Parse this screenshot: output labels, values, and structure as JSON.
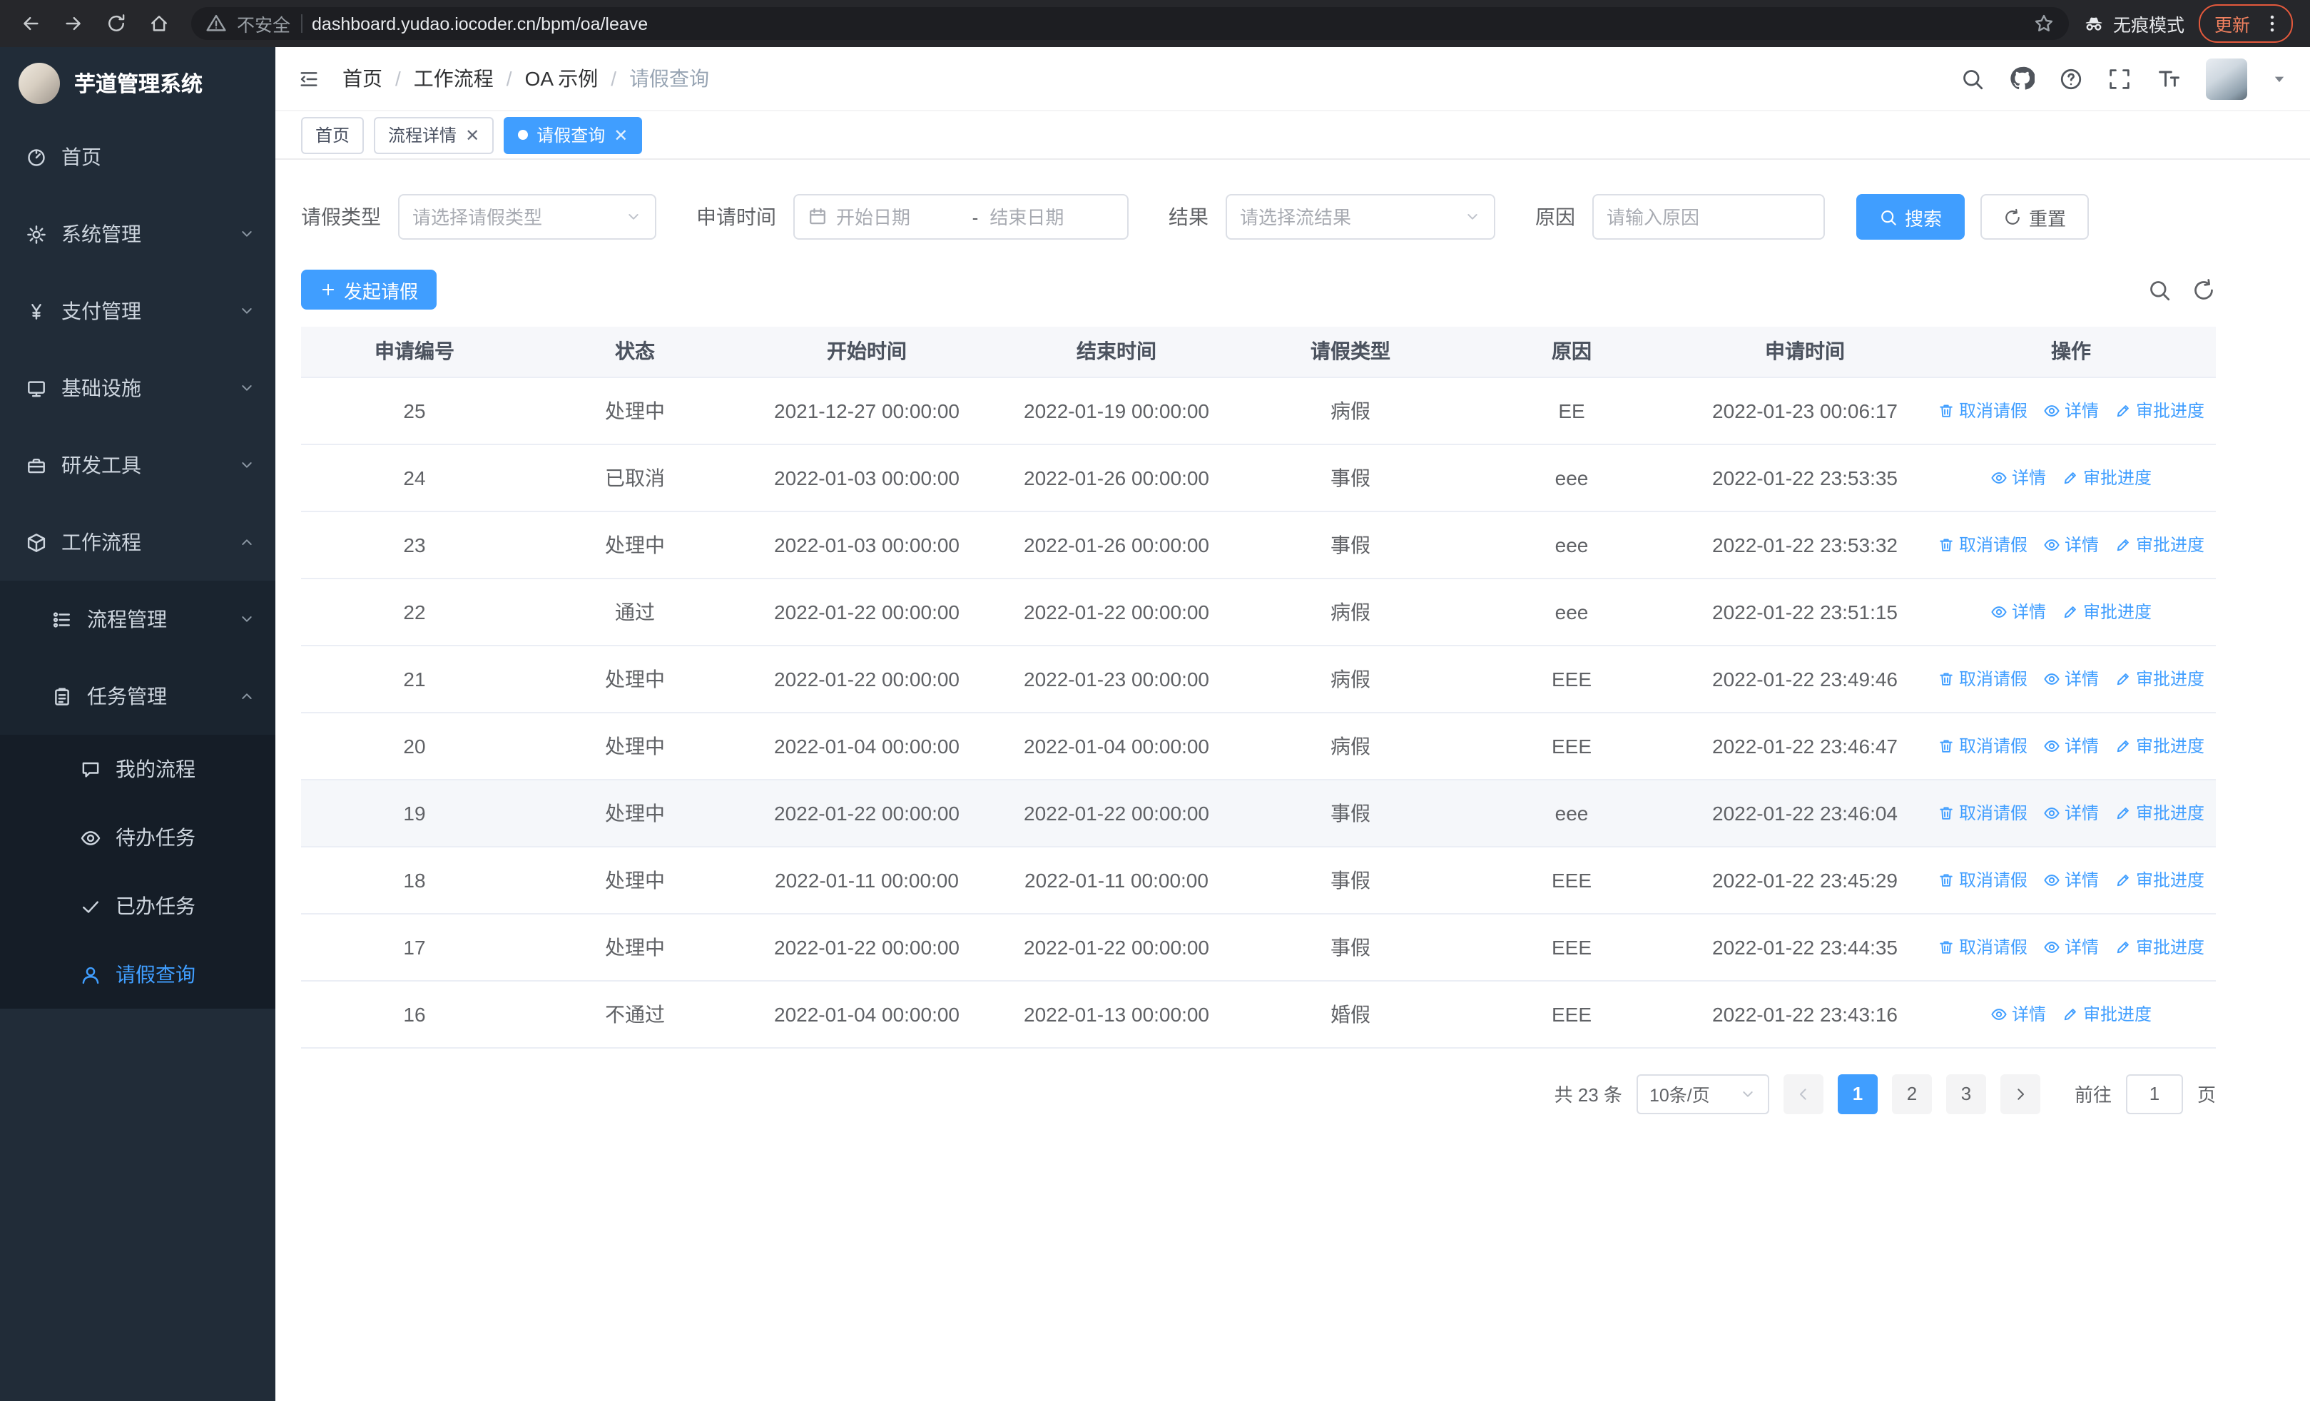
{
  "colors": {
    "primary": "#409eff",
    "sidebar_bg": "#212c38",
    "link": "#409eff"
  },
  "browser": {
    "security_label": "不安全",
    "url": "dashboard.yudao.iocoder.cn/bpm/oa/leave",
    "incognito_label": "无痕模式",
    "update_label": "更新"
  },
  "sidebar": {
    "logo_title": "芋道管理系统",
    "items": [
      {
        "key": "home",
        "label": "首页",
        "icon": "dashboard-icon",
        "depth": 0,
        "expandable": false
      },
      {
        "key": "system",
        "label": "系统管理",
        "icon": "gear-icon",
        "depth": 0,
        "expandable": true,
        "expanded": false
      },
      {
        "key": "payment",
        "label": "支付管理",
        "icon": "yen-icon",
        "depth": 0,
        "expandable": true,
        "expanded": false
      },
      {
        "key": "infra",
        "label": "基础设施",
        "icon": "monitor-icon",
        "depth": 0,
        "expandable": true,
        "expanded": false
      },
      {
        "key": "devtools",
        "label": "研发工具",
        "icon": "toolbox-icon",
        "depth": 0,
        "expandable": true,
        "expanded": false
      },
      {
        "key": "workflow",
        "label": "工作流程",
        "icon": "workflow-icon",
        "depth": 0,
        "expandable": true,
        "expanded": true
      },
      {
        "key": "process-mgmt",
        "label": "流程管理",
        "icon": "flow-icon",
        "depth": 1,
        "expandable": true,
        "expanded": false
      },
      {
        "key": "task-mgmt",
        "label": "任务管理",
        "icon": "task-icon",
        "depth": 1,
        "expandable": true,
        "expanded": true
      },
      {
        "key": "my-processes",
        "label": "我的流程",
        "icon": "chat-icon",
        "depth": 2,
        "expandable": false
      },
      {
        "key": "todo-tasks",
        "label": "待办任务",
        "icon": "eye-icon",
        "depth": 2,
        "expandable": false
      },
      {
        "key": "done-tasks",
        "label": "已办任务",
        "icon": "done-icon",
        "depth": 2,
        "expandable": false
      },
      {
        "key": "leave-query",
        "label": "请假查询",
        "icon": "user-icon",
        "depth": 2,
        "expandable": false,
        "active": true
      }
    ]
  },
  "header": {
    "breadcrumb": [
      "首页",
      "工作流程",
      "OA 示例",
      "请假查询"
    ]
  },
  "tabs": [
    {
      "key": "home",
      "label": "首页",
      "closable": false,
      "active": false
    },
    {
      "key": "process-detail",
      "label": "流程详情",
      "closable": true,
      "active": false
    },
    {
      "key": "leave-query",
      "label": "请假查询",
      "closable": true,
      "active": true
    }
  ],
  "filters": {
    "leave_type_label": "请假类型",
    "leave_type_placeholder": "请选择请假类型",
    "apply_time_label": "申请时间",
    "date_start_placeholder": "开始日期",
    "date_separator": "-",
    "date_end_placeholder": "结束日期",
    "result_label": "结果",
    "result_placeholder": "请选择流结果",
    "reason_label": "原因",
    "reason_placeholder": "请输入原因",
    "search_label": "搜索",
    "reset_label": "重置"
  },
  "toolbar": {
    "create_label": "发起请假"
  },
  "table": {
    "columns": [
      {
        "key": "id",
        "label": "申请编号"
      },
      {
        "key": "status",
        "label": "状态"
      },
      {
        "key": "start",
        "label": "开始时间"
      },
      {
        "key": "end",
        "label": "结束时间"
      },
      {
        "key": "type",
        "label": "请假类型"
      },
      {
        "key": "reason",
        "label": "原因"
      },
      {
        "key": "applied",
        "label": "申请时间"
      },
      {
        "key": "actions",
        "label": "操作"
      }
    ],
    "action_labels": {
      "cancel": {
        "label": "取消请假",
        "icon": "trash-icon"
      },
      "detail": {
        "label": "详情",
        "icon": "eye-icon"
      },
      "progress": {
        "label": "审批进度",
        "icon": "edit-icon"
      }
    },
    "rows": [
      {
        "id": "25",
        "status": "处理中",
        "start": "2021-12-27 00:00:00",
        "end": "2022-01-19 00:00:00",
        "type": "病假",
        "reason": "EE",
        "applied": "2022-01-23 00:06:17",
        "actions": [
          "cancel",
          "detail",
          "progress"
        ]
      },
      {
        "id": "24",
        "status": "已取消",
        "start": "2022-01-03 00:00:00",
        "end": "2022-01-26 00:00:00",
        "type": "事假",
        "reason": "eee",
        "applied": "2022-01-22 23:53:35",
        "actions": [
          "detail",
          "progress"
        ]
      },
      {
        "id": "23",
        "status": "处理中",
        "start": "2022-01-03 00:00:00",
        "end": "2022-01-26 00:00:00",
        "type": "事假",
        "reason": "eee",
        "applied": "2022-01-22 23:53:32",
        "actions": [
          "cancel",
          "detail",
          "progress"
        ]
      },
      {
        "id": "22",
        "status": "通过",
        "start": "2022-01-22 00:00:00",
        "end": "2022-01-22 00:00:00",
        "type": "病假",
        "reason": "eee",
        "applied": "2022-01-22 23:51:15",
        "actions": [
          "detail",
          "progress"
        ]
      },
      {
        "id": "21",
        "status": "处理中",
        "start": "2022-01-22 00:00:00",
        "end": "2022-01-23 00:00:00",
        "type": "病假",
        "reason": "EEE",
        "applied": "2022-01-22 23:49:46",
        "actions": [
          "cancel",
          "detail",
          "progress"
        ]
      },
      {
        "id": "20",
        "status": "处理中",
        "start": "2022-01-04 00:00:00",
        "end": "2022-01-04 00:00:00",
        "type": "病假",
        "reason": "EEE",
        "applied": "2022-01-22 23:46:47",
        "actions": [
          "cancel",
          "detail",
          "progress"
        ]
      },
      {
        "id": "19",
        "status": "处理中",
        "start": "2022-01-22 00:00:00",
        "end": "2022-01-22 00:00:00",
        "type": "事假",
        "reason": "eee",
        "applied": "2022-01-22 23:46:04",
        "actions": [
          "cancel",
          "detail",
          "progress"
        ],
        "highlight": true
      },
      {
        "id": "18",
        "status": "处理中",
        "start": "2022-01-11 00:00:00",
        "end": "2022-01-11 00:00:00",
        "type": "事假",
        "reason": "EEE",
        "applied": "2022-01-22 23:45:29",
        "actions": [
          "cancel",
          "detail",
          "progress"
        ]
      },
      {
        "id": "17",
        "status": "处理中",
        "start": "2022-01-22 00:00:00",
        "end": "2022-01-22 00:00:00",
        "type": "事假",
        "reason": "EEE",
        "applied": "2022-01-22 23:44:35",
        "actions": [
          "cancel",
          "detail",
          "progress"
        ]
      },
      {
        "id": "16",
        "status": "不通过",
        "start": "2022-01-04 00:00:00",
        "end": "2022-01-13 00:00:00",
        "type": "婚假",
        "reason": "EEE",
        "applied": "2022-01-22 23:43:16",
        "actions": [
          "detail",
          "progress"
        ]
      }
    ]
  },
  "pagination": {
    "total_label": "共 23 条",
    "page_size": "10条/页",
    "pages": [
      "1",
      "2",
      "3"
    ],
    "active_page": "1",
    "goto_label": "前往",
    "goto_value": "1",
    "goto_suffix": "页"
  }
}
